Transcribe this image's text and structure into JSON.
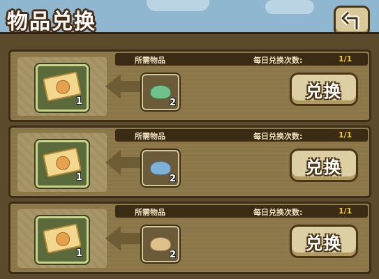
{
  "header": {
    "title": "物品兑换",
    "back_icon": "return-arrow-icon"
  },
  "labels": {
    "required": "所需物品",
    "daily_limit": "每日兑换次数:"
  },
  "rows": [
    {
      "reward": {
        "icon": "ticket-icon",
        "count": "1"
      },
      "required": {
        "icon": "green-gem-icon",
        "count": "2",
        "color": "#6fc38a"
      },
      "limit": "1/1",
      "button": "兑换"
    },
    {
      "reward": {
        "icon": "ticket-icon",
        "count": "1"
      },
      "required": {
        "icon": "blue-gem-icon",
        "count": "2",
        "color": "#7fb0d8"
      },
      "limit": "1/1",
      "button": "兑换"
    },
    {
      "reward": {
        "icon": "ticket-icon",
        "count": "1"
      },
      "required": {
        "icon": "tan-gem-icon",
        "count": "2",
        "color": "#e0c08a"
      },
      "limit": "1/1",
      "button": "兑换"
    }
  ],
  "colors": {
    "limit_value": "#f2c83c",
    "frame": "#3b2d16"
  }
}
